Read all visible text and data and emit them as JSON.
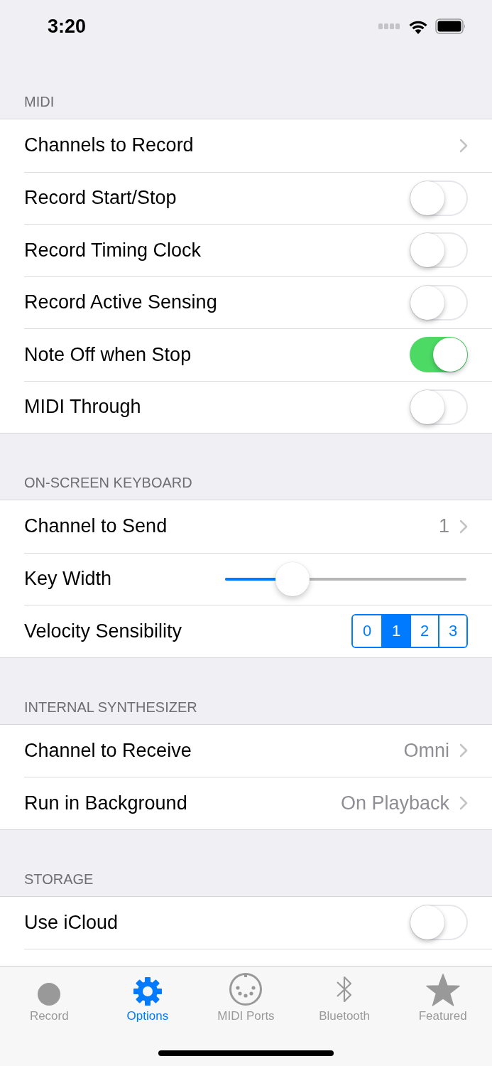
{
  "status_bar": {
    "time": "3:20"
  },
  "sections": [
    {
      "header": "MIDI",
      "rows": [
        {
          "kind": "disclosure",
          "label": "Channels to Record"
        },
        {
          "kind": "toggle",
          "label": "Record Start/Stop",
          "on": false
        },
        {
          "kind": "toggle",
          "label": "Record Timing Clock",
          "on": false
        },
        {
          "kind": "toggle",
          "label": "Record Active Sensing",
          "on": false
        },
        {
          "kind": "toggle",
          "label": "Note Off when Stop",
          "on": true
        },
        {
          "kind": "toggle",
          "label": "MIDI Through",
          "on": false
        }
      ]
    },
    {
      "header": "ON-SCREEN KEYBOARD",
      "rows": [
        {
          "kind": "disclosure",
          "label": "Channel to Send",
          "value": "1"
        },
        {
          "kind": "slider",
          "label": "Key Width",
          "level": 0.28
        },
        {
          "kind": "segmented",
          "label": "Velocity Sensibility",
          "options": [
            {
              "label": "0",
              "selected": false
            },
            {
              "label": "1",
              "selected": true
            },
            {
              "label": "2",
              "selected": false
            },
            {
              "label": "3",
              "selected": false
            }
          ]
        }
      ]
    },
    {
      "header": "INTERNAL SYNTHESIZER",
      "rows": [
        {
          "kind": "disclosure",
          "label": "Channel to Receive",
          "value": "Omni"
        },
        {
          "kind": "disclosure",
          "label": "Run in Background",
          "value": "On Playback"
        }
      ]
    },
    {
      "header": "STORAGE",
      "rows": [
        {
          "kind": "toggle",
          "label": "Use iCloud",
          "on": false
        }
      ]
    }
  ],
  "tab_bar": [
    {
      "kind": "record",
      "label": "Record",
      "selected": false
    },
    {
      "kind": "gear",
      "label": "Options",
      "selected": true
    },
    {
      "kind": "midi",
      "label": "MIDI Ports",
      "selected": false
    },
    {
      "kind": "bluetooth",
      "label": "Bluetooth",
      "selected": false
    },
    {
      "kind": "star",
      "label": "Featured",
      "selected": false
    }
  ]
}
